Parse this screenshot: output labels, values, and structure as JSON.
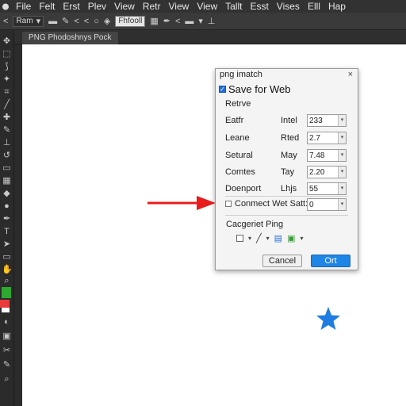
{
  "menubar": {
    "items": [
      "File",
      "Felt",
      "Erst",
      "Plev",
      "View",
      "Retr",
      "View",
      "View",
      "Tallt",
      "Esst",
      "Vises",
      "Elll",
      "Hap"
    ]
  },
  "optionsbar": {
    "select_value": "Ram",
    "input_value": "Fhfooll"
  },
  "document": {
    "tab_label": "PNG Phodoshnys Pock"
  },
  "dialog": {
    "title": "png imatch",
    "close": "×",
    "heading": "Save for Web",
    "section_label": "Retrve",
    "rows": [
      {
        "label": "Eatfr",
        "sublabel": "Intel",
        "value": "233"
      },
      {
        "label": "Leane",
        "sublabel": "Rted",
        "value": "2.7"
      },
      {
        "label": "Setural",
        "sublabel": "May",
        "value": "7.48"
      },
      {
        "label": "Comtes",
        "sublabel": "Tay",
        "value": "2.20"
      },
      {
        "label": "Doenport",
        "sublabel": "Lhjs",
        "value": "55"
      }
    ],
    "connect_label": "Conmect Wet Satt:",
    "connect_value": "0",
    "categories_label": "Cacgeriet Ping",
    "cancel_label": "Cancel",
    "ok_label": "Ort"
  },
  "colors": {
    "accent": "#1e86e6",
    "arrow": "#e81c1c",
    "star": "#1f7ce0",
    "fg_swatch": "#2fa82f",
    "bg_swatch": "#e83a3a"
  }
}
